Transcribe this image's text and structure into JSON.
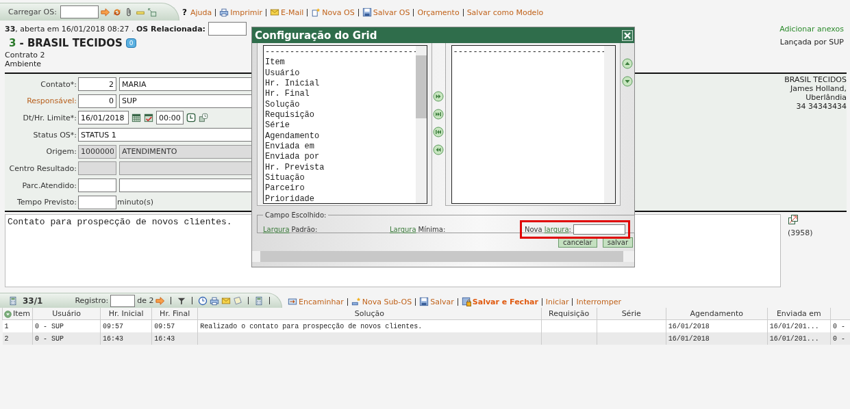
{
  "top_toolbar": {
    "load_label": "Carregar OS:",
    "links": [
      {
        "glyph": "?",
        "label": "Ajuda"
      },
      {
        "label": "Imprimir"
      },
      {
        "label": "E-Mail"
      },
      {
        "label": "Nova OS"
      },
      {
        "label": "Salvar OS"
      },
      {
        "label": "Orçamento"
      },
      {
        "label": "Salvar como Modelo"
      }
    ]
  },
  "header": {
    "summary": "**33**, aberta em 16/01/2018 08:27 . **OS Relacionada:**",
    "client_code": "3",
    "client_name": "- BRASIL TECIDOS",
    "badge": "0",
    "lines": [
      "Contrato 2",
      "Ambiente"
    ],
    "attach_link": "Adicionar anexos",
    "launched_by": "Lançada por SUP"
  },
  "form": {
    "fields": [
      {
        "kind": "pair",
        "label": "Contato*:",
        "link": false,
        "disabled": false,
        "code": "2",
        "value": "MARIA"
      },
      {
        "kind": "pair",
        "label": "Responsável:",
        "link": true,
        "disabled": false,
        "code": "0",
        "value": "SUP"
      },
      {
        "kind": "datetime",
        "label": "Dt/Hr. Limite*:",
        "link": false,
        "date": "16/01/2018",
        "time": "00:00"
      },
      {
        "kind": "single",
        "label": "Status OS*:",
        "link": false,
        "value": "STATUS 1"
      },
      {
        "kind": "pair",
        "label": "Origem:",
        "link": false,
        "disabled": true,
        "code": "1000000",
        "value": "ATENDIMENTO"
      },
      {
        "kind": "pair",
        "label": "Centro Resultado:",
        "link": false,
        "disabled": true
      },
      {
        "kind": "pair",
        "label": "Parc.Atendido:",
        "link": false,
        "disabled": false
      },
      {
        "kind": "minutes",
        "label": "Tempo Previsto:",
        "link": false,
        "unit": "minuto(s)"
      }
    ],
    "address": [
      "BRASIL TECIDOS",
      "James Holland,",
      "Uberlândia",
      "34 34343434"
    ]
  },
  "description": {
    "text": "Contato para prospecção de novos clientes.",
    "char_count": "(3958)"
  },
  "sub_toolbar": {
    "count": "33/1",
    "registro_label": "Registro:",
    "total": "de 2",
    "links": [
      {
        "label": "Encaminhar",
        "bold": false
      },
      {
        "label": "Nova Sub-OS",
        "bold": false
      },
      {
        "label": "Salvar",
        "bold": false
      },
      {
        "label": "Salvar e Fechar",
        "bold": true
      },
      {
        "label": "Iniciar",
        "bold": false
      },
      {
        "label": "Interromper",
        "bold": false
      }
    ]
  },
  "table": {
    "columns": [
      "Item",
      "Usuário",
      "Hr. Inicial",
      "Hr. Final",
      "Solução",
      "Requisição",
      "Série",
      "Agendamento",
      "Enviada em"
    ],
    "rows": [
      [
        "1",
        "0 - SUP",
        "09:57",
        "09:57",
        "Realizado o contato para prospecção de novos clientes.",
        null,
        null,
        "16/01/2018",
        "16/01/201...",
        "0 -"
      ],
      [
        "2",
        "0 - SUP",
        "16:43",
        "16:43",
        null,
        null,
        null,
        "16/01/2018",
        "16/01/201...",
        "0 -"
      ]
    ]
  },
  "dialog": {
    "title": "Configuração do Grid",
    "available": [
      "-------------------------------",
      "Item",
      "Usuário",
      "Hr. Inicial",
      "Hr. Final",
      "Solução",
      "Requisição",
      "Série",
      "Agendamento",
      "Enviada em",
      "Enviada por",
      "Hr. Prevista",
      "Situação",
      "Parceiro",
      "Prioridade"
    ],
    "chosen": [
      "-------------------------------"
    ],
    "chosen_field": {
      "legend": "Campo Escolhido:",
      "default_width": {
        "link": "Largura",
        "label": "Padrão:"
      },
      "min_width": {
        "link": "Largura",
        "label": "Mínima:"
      },
      "new_width": {
        "prefix": "Nova ",
        "link": "largura",
        "suffix": ":",
        "highlighted": true
      }
    },
    "buttons": [
      "cancelar",
      "salvar"
    ]
  }
}
